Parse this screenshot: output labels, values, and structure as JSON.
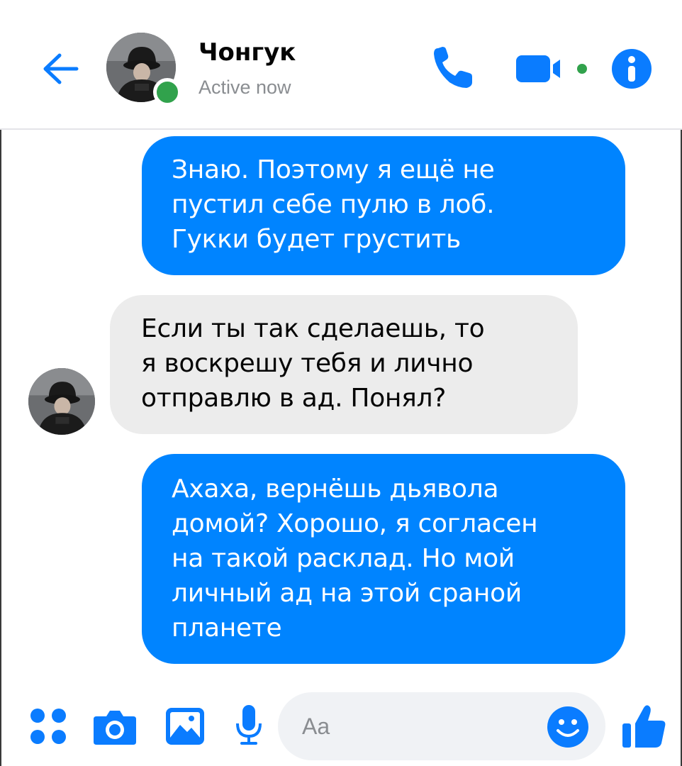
{
  "header": {
    "contact_name": "Чонгук",
    "contact_status": "Active now",
    "icons": {
      "back": "back-arrow-icon",
      "call": "phone-icon",
      "video": "video-camera-icon",
      "info": "info-icon"
    },
    "online_status_color": "#31a24c"
  },
  "messages": [
    {
      "direction": "outgoing",
      "lines": [
        "Знаю. Поэтому я ещё не",
        "пустил себе пулю в лоб.",
        "Гукки будет грустить"
      ]
    },
    {
      "direction": "incoming",
      "lines": [
        "Если ты так сделаешь, то",
        "я воскрешу тебя и лично",
        "отправлю в ад. Понял?"
      ]
    },
    {
      "direction": "outgoing",
      "lines": [
        "Ахаха, вернёшь дьявола",
        "домой? Хорошо, я согласен",
        "на такой расклад. Но мой",
        "личный ад на этой сраной",
        "планете"
      ]
    }
  ],
  "composer": {
    "placeholder": "Aa",
    "icons": [
      "menu-dots-icon",
      "camera-icon",
      "gallery-icon",
      "microphone-icon",
      "emoji-icon",
      "thumbs-up-icon"
    ]
  },
  "colors": {
    "accent": "#0084ff",
    "incoming_bubble": "#ececec",
    "composer_bg": "#f0f2f5"
  }
}
